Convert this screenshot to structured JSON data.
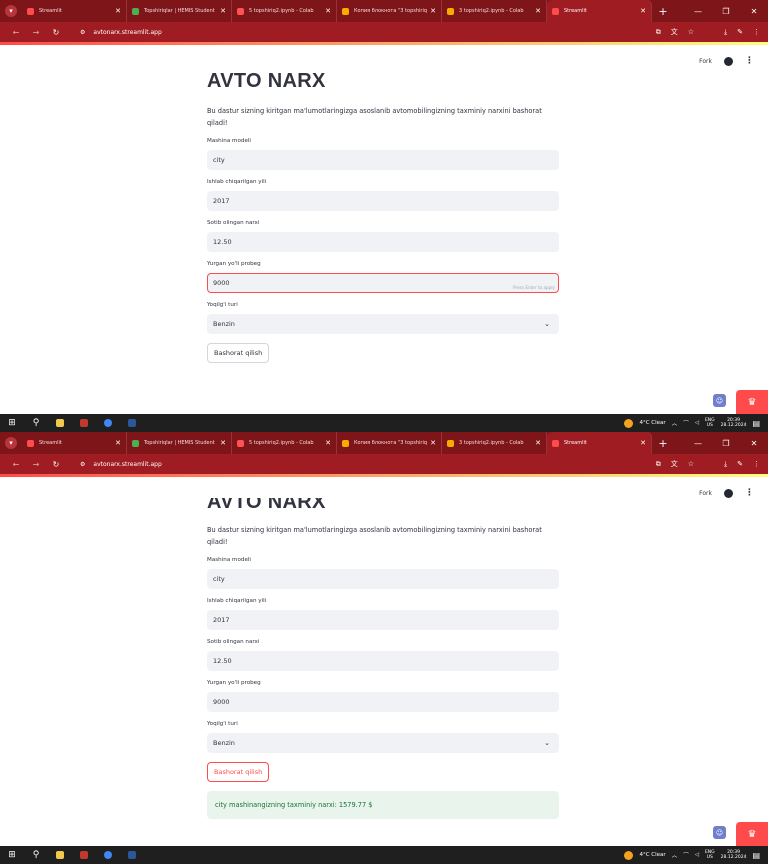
{
  "browser": {
    "tabs": [
      {
        "title": "Streamlit",
        "fav_color": "#ff4b4b",
        "active": false
      },
      {
        "title": "Topshiriqlar | HEMIS Student",
        "fav_color": "#4caf50",
        "active": false
      },
      {
        "title": "5 topshiriq2.ipynb - Colab",
        "fav_color": "#ff5252",
        "active": false
      },
      {
        "title": "Копия блокнота \"3 topshiriq\"",
        "fav_color": "#f9ab00",
        "active": false
      },
      {
        "title": "3 topshiriq2.ipynb - Colab",
        "fav_color": "#f9ab00",
        "active": false
      },
      {
        "title": "Streamlit",
        "fav_color": "#ff4b4b",
        "active": true
      }
    ],
    "url": "avtonarx.streamlit.app",
    "tab_strip_color": "#7e1519",
    "toolbar_color": "#9e1c22"
  },
  "streamlit_header": {
    "fork_label": "Fork"
  },
  "app": {
    "title": "AVTO NARX",
    "title_clipped": "AVTO NARX",
    "description": "Bu dastur sizning kiritgan ma'lumotlaringizga asoslanib avtomobilingizning taxminiy narxini bashorat qiladi!",
    "fields": {
      "model": {
        "label": "Mashina modeli",
        "value": "city"
      },
      "year": {
        "label": "Ishlab chiqarilgan yili",
        "value": "2017"
      },
      "price": {
        "label": "Sotib olingan narxi",
        "value": "12.50"
      },
      "mileage": {
        "label": "Yurgan yo'li probeg",
        "value": "9000",
        "hint": "Press Enter to apply"
      },
      "fuel": {
        "label": "Yoqilg'i turi",
        "value": "Benzin"
      }
    },
    "predict_button": "Bashorat qilish",
    "result_text": "city mashinangizning taxminiy narxi: 1579.77 $",
    "accent_color": "#ff4b4b",
    "success_color": "#177233"
  },
  "taskbar": {
    "weather": "4°C  Clear",
    "lang_top": "ENG",
    "lang_bottom": "US",
    "time": "20:39",
    "date": "28.12.2024"
  }
}
